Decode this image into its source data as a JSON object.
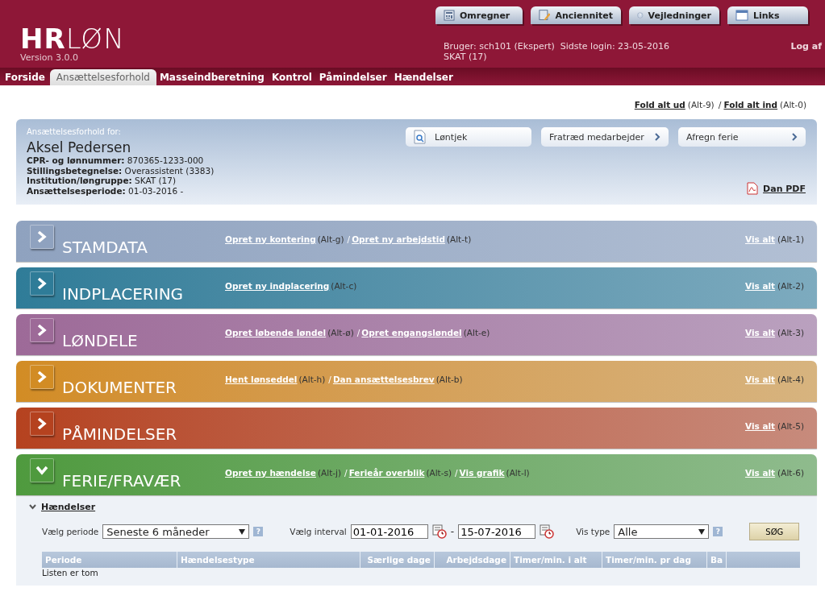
{
  "header": {
    "logo_bold": "HR",
    "logo_light": "LØN",
    "version": "Version 3.0.0",
    "user_line": "Bruger: sch101 (Ekspert)  Sidste login: 23-05-2016",
    "org_line": "SKAT (17)",
    "logout": "Log af"
  },
  "top_tabs": [
    {
      "label": "Omregner"
    },
    {
      "label": "Anciennitet"
    },
    {
      "label": "Vejledninger"
    },
    {
      "label": "Links"
    }
  ],
  "nav": [
    {
      "label": "Forside",
      "selected": false
    },
    {
      "label": "Ansættelsesforhold",
      "selected": true
    },
    {
      "label": "Masseindberetning",
      "selected": false
    },
    {
      "label": "Kontrol",
      "selected": false
    },
    {
      "label": "Påmindelser",
      "selected": false
    },
    {
      "label": "Hændelser",
      "selected": false
    }
  ],
  "fold_links": [
    {
      "kind": "link",
      "text": "Fold alt ud"
    },
    {
      "kind": "note",
      "text": "(Alt-9)"
    },
    {
      "kind": "sep",
      "text": "/"
    },
    {
      "kind": "link",
      "text": "Fold alt ind"
    },
    {
      "kind": "note",
      "text": "(Alt-0)"
    }
  ],
  "employee": {
    "caption": "Ansættelsesforhold for:",
    "name": "Aksel Pedersen",
    "details": [
      "**CPR- og lønnummer:** 870365-1233-000",
      "**Stillingsbetegnelse:** Overassistent (3383)",
      "**Institution/løngruppe:** SKAT (17)",
      "**Ansættelsesperiode:** 01-03-2016 -"
    ],
    "buttons": [
      {
        "label": "Løntjek",
        "kind": "icon"
      },
      {
        "label": "Fratræd medarbejder",
        "kind": "chevron"
      },
      {
        "label": "Afregn ferie",
        "kind": "chevron"
      }
    ],
    "pdf": "Dan PDF"
  },
  "sections": [
    {
      "title": "STAMDATA",
      "expanded": false,
      "color": "#8fa2bf",
      "actions": [
        {
          "kind": "link",
          "text": "Opret ny kontering"
        },
        {
          "kind": "note",
          "text": "(Alt-g)"
        },
        {
          "kind": "sep",
          "text": "/"
        },
        {
          "kind": "link",
          "text": "Opret ny arbejdstid"
        },
        {
          "kind": "note",
          "text": "(Alt-t)"
        }
      ],
      "show_all": "Vis alt",
      "show_all_key": "(Alt-1)"
    },
    {
      "title": "INDPLACERING",
      "expanded": false,
      "color": "#2f7c98",
      "actions": [
        {
          "kind": "link",
          "text": "Opret ny indplacering"
        },
        {
          "kind": "note",
          "text": "(Alt-c)"
        }
      ],
      "show_all": "Vis alt",
      "show_all_key": "(Alt-2)"
    },
    {
      "title": "LØNDELE",
      "expanded": false,
      "color": "#9d6a98",
      "actions": [
        {
          "kind": "link",
          "text": "Opret løbende løndel"
        },
        {
          "kind": "note",
          "text": "(Alt-ø)"
        },
        {
          "kind": "sep",
          "text": "/"
        },
        {
          "kind": "link",
          "text": "Opret engangsløndel"
        },
        {
          "kind": "note",
          "text": "(Alt-e)"
        }
      ],
      "show_all": "Vis alt",
      "show_all_key": "(Alt-3)"
    },
    {
      "title": "DOKUMENTER",
      "expanded": false,
      "color": "#d28c24",
      "actions": [
        {
          "kind": "link",
          "text": "Hent lønseddel"
        },
        {
          "kind": "note",
          "text": "(Alt-h)"
        },
        {
          "kind": "sep",
          "text": "/"
        },
        {
          "kind": "link",
          "text": "Dan ansættelsesbrev"
        },
        {
          "kind": "note",
          "text": "(Alt-b)"
        }
      ],
      "show_all": "Vis alt",
      "show_all_key": "(Alt-4)"
    },
    {
      "title": "PÅMINDELSER",
      "expanded": false,
      "color": "#b5421f",
      "show_all": "Vis alt",
      "show_all_key": "(Alt-5)"
    },
    {
      "title": "FERIE/FRAVÆR",
      "expanded": true,
      "color": "#4f9a3e",
      "actions": [
        {
          "kind": "link",
          "text": "Opret ny hændelse"
        },
        {
          "kind": "note",
          "text": "(Alt-j)"
        },
        {
          "kind": "sep",
          "text": "/"
        },
        {
          "kind": "link",
          "text": "Ferieår overblik"
        },
        {
          "kind": "note",
          "text": "(Alt-s)"
        },
        {
          "kind": "sep",
          "text": "/"
        },
        {
          "kind": "link",
          "text": "Vis grafik"
        },
        {
          "kind": "note",
          "text": "(Alt-l)"
        }
      ],
      "show_all": "Vis alt",
      "show_all_key": "(Alt-6)"
    }
  ],
  "events": {
    "title": "Hændelser",
    "expanded": true,
    "period_label": "Vælg periode",
    "period_value": "Seneste 6 måneder",
    "interval_label": "Vælg interval",
    "from": "01-01-2016",
    "dash": "-",
    "to": "15-07-2016",
    "type_label": "Vis type",
    "type_value": "Alle",
    "help": "?",
    "search": "SØG",
    "columns": [
      "Periode",
      "Hændelsestype",
      "Særlige dage",
      "Arbejdsdage",
      "Timer/min. i alt",
      "Timer/min. pr dag",
      "Ba"
    ],
    "empty": "Listen er tom"
  }
}
